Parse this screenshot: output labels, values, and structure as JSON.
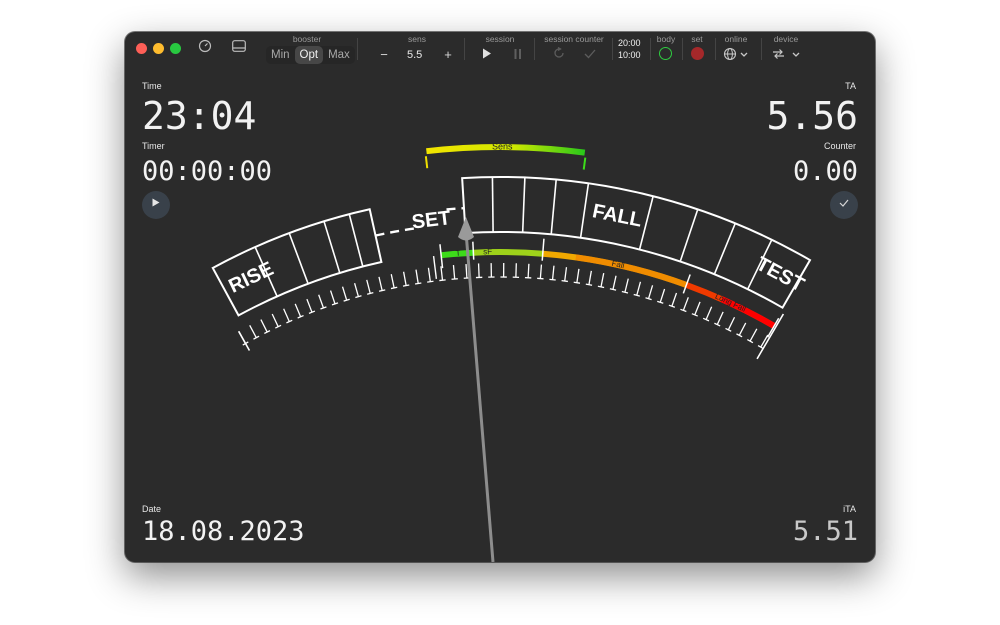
{
  "toolbar": {
    "booster": {
      "label": "booster",
      "options": [
        "Min",
        "Opt",
        "Max"
      ],
      "selected": "Opt"
    },
    "sens": {
      "label": "sens",
      "minus": "−",
      "value": "5.5",
      "plus": "+"
    },
    "session": {
      "label": "session",
      "play_icon": "play-icon",
      "pause_icon": "pause-icon"
    },
    "session_counter": {
      "label": "session counter",
      "reset_icon": "reset-icon",
      "check_icon": "check-icon"
    },
    "clock": {
      "top": "20:00",
      "bottom": "10:00"
    },
    "body": {
      "label": "body",
      "color": "#2ecc40"
    },
    "set": {
      "label": "set",
      "color": "#b02a2a"
    },
    "online": {
      "label": "online",
      "icon": "globe-icon"
    },
    "device": {
      "label": "device",
      "icon": "sync-icon"
    }
  },
  "left": {
    "time_label": "Time",
    "time_value": "23:04",
    "timer_label": "Timer",
    "timer_value": "00:00:00",
    "play_icon": "play-icon",
    "date_label": "Date",
    "date_value": "18.08.2023"
  },
  "right": {
    "ta_label": "TA",
    "ta_value": "5.56",
    "counter_label": "Counter",
    "counter_value": "0.00",
    "check_icon": "check-icon",
    "ita_label": "iTA",
    "ita_value": "5.51"
  },
  "dial": {
    "words": {
      "rise": "RISE",
      "set": "SET",
      "fall": "FALL",
      "test": "TEST"
    },
    "sens_bar_label": "Sens",
    "zone_labels": {
      "t": "T",
      "sf": "sF",
      "fall": "Fall",
      "long_fall": "Long Fall"
    },
    "colors": {
      "yellow": "#f0e000",
      "green": "#3ddc1a",
      "orange": "#f07a00",
      "red": "#ff0000",
      "needle": "#9a9a9a"
    }
  }
}
